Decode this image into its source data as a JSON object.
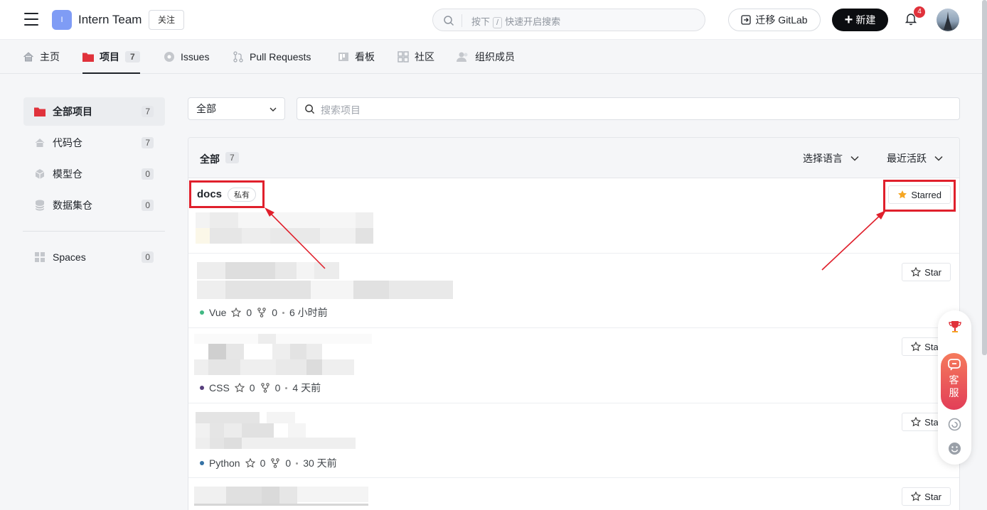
{
  "header": {
    "team_avatar_letter": "I",
    "team_name": "Intern Team",
    "follow_label": "关注",
    "search_hint_prefix": "按下",
    "search_hint_key": "/",
    "search_hint_suffix": "快速开启搜索",
    "migrate_label": "迁移 GitLab",
    "new_label": "新建",
    "notification_count": "4"
  },
  "nav": {
    "home": "主页",
    "projects": "项目",
    "projects_count": "7",
    "issues": "Issues",
    "pull_requests": "Pull Requests",
    "kanban": "看板",
    "community": "社区",
    "members": "组织成员"
  },
  "sidebar": {
    "items": [
      {
        "label": "全部项目",
        "count": "7"
      },
      {
        "label": "代码仓",
        "count": "7"
      },
      {
        "label": "模型仓",
        "count": "0"
      },
      {
        "label": "数据集仓",
        "count": "0"
      },
      {
        "label": "Spaces",
        "count": "0"
      }
    ]
  },
  "filter": {
    "select_value": "全部",
    "search_placeholder": "搜索项目"
  },
  "list": {
    "title": "全部",
    "count": "7",
    "language_label": "选择语言",
    "sort_label": "最近活跃",
    "rows": [
      {
        "name": "docs",
        "tag": "私有",
        "star_label": "Starred"
      },
      {
        "star_label": "Star",
        "language": "Vue",
        "lang_color": "#41b883",
        "stars": "0",
        "forks": "0",
        "time": "6 小时前"
      },
      {
        "star_label": "Star",
        "language": "CSS",
        "lang_color": "#563d7c",
        "stars": "0",
        "forks": "0",
        "time": "4 天前"
      },
      {
        "star_label": "Star",
        "language": "Python",
        "lang_color": "#3572a5",
        "stars": "0",
        "forks": "0",
        "time": "30 天前"
      },
      {
        "star_label": "Star"
      }
    ]
  },
  "float_widget": {
    "service_label_1": "客",
    "service_label_2": "服"
  },
  "colors": {
    "accent_red": "#e0202c",
    "star_filled": "#f5a623",
    "primary_dark": "#0b0d10"
  }
}
